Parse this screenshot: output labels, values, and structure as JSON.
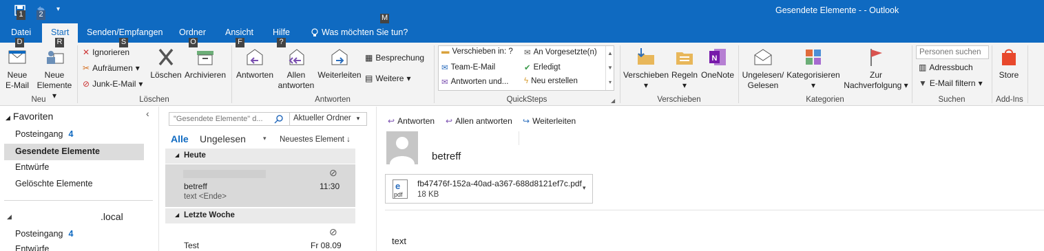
{
  "window": {
    "title": "Gesendete Elemente -  -  Outlook"
  },
  "qat": {
    "key1": "1",
    "key2": "2"
  },
  "tabs": [
    {
      "label": "Datei",
      "key": "D"
    },
    {
      "label": "Start",
      "key": "R"
    },
    {
      "label": "Senden/Empfangen",
      "key": "S"
    },
    {
      "label": "Ordner",
      "key": "O"
    },
    {
      "label": "Ansicht",
      "key": "F"
    },
    {
      "label": "Hilfe",
      "key": "?"
    },
    {
      "label": "Was möchten Sie tun?",
      "key": "M"
    }
  ],
  "ribbon": {
    "neu": {
      "label": "Neu",
      "new_email": [
        "Neue",
        "E-Mail"
      ],
      "new_items": [
        "Neue",
        "Elemente"
      ]
    },
    "loeschen": {
      "label": "Löschen",
      "ignore": "Ignorieren",
      "cleanup": "Aufräumen",
      "junk": "Junk-E-Mail",
      "delete": "Löschen",
      "archive": "Archivieren"
    },
    "antworten": {
      "label": "Antworten",
      "reply": "Antworten",
      "reply_all": [
        "Allen",
        "antworten"
      ],
      "forward": "Weiterleiten",
      "meeting": "Besprechung",
      "more": "Weitere"
    },
    "quicksteps": {
      "label": "QuickSteps",
      "items": [
        "Verschieben in: ?",
        "Team-E-Mail",
        "Antworten und...",
        "An Vorgesetzte(n)",
        "Erledigt",
        "Neu erstellen"
      ]
    },
    "verschieben": {
      "label": "Verschieben",
      "move": "Verschieben",
      "rules": "Regeln",
      "onenote": "OneNote"
    },
    "kategorien": {
      "label": "Kategorien",
      "unread": [
        "Ungelesen/",
        "Gelesen"
      ],
      "categorize": "Kategorisieren",
      "followup": [
        "Zur",
        "Nachverfolgung"
      ]
    },
    "suchen": {
      "label": "Suchen",
      "search_people_placeholder": "Personen suchen",
      "address_book": "Adressbuch",
      "filter": "E-Mail filtern"
    },
    "addins": {
      "label": "Add-Ins",
      "store": "Store"
    }
  },
  "nav": {
    "favorites": "Favoriten",
    "fav_items": [
      {
        "label": "Posteingang",
        "count": "4"
      },
      {
        "label": "Gesendete Elemente"
      },
      {
        "label": "Entwürfe"
      },
      {
        "label": "Gelöschte Elemente"
      }
    ],
    "account": ".local",
    "acct_items": [
      {
        "label": "Posteingang",
        "count": "4"
      },
      {
        "label": "Entwürfe"
      }
    ]
  },
  "list": {
    "search_placeholder": "\"Gesendete Elemente\" d...",
    "scope": "Aktueller Ordner",
    "filter_all": "Alle",
    "filter_unread": "Ungelesen",
    "sort": "Neuestes Element",
    "groups": [
      {
        "label": "Heute",
        "items": [
          {
            "subject": "betreff",
            "preview": "text <Ende>",
            "time": "11:30"
          }
        ]
      },
      {
        "label": "Letzte Woche",
        "items": [
          {
            "subject": "Test",
            "time": "Fr 08.09"
          }
        ]
      }
    ]
  },
  "reading": {
    "actions": [
      "Antworten",
      "Allen antworten",
      "Weiterleiten"
    ],
    "subject": "betreff",
    "attachment": {
      "name": "fb47476f-152a-40ad-a367-688d8121ef7c.pdf",
      "size": "18 KB",
      "ext": "pdf"
    },
    "body": "text"
  },
  "colors": {
    "accent": "#0f6ac1",
    "selected": "#dcdcdc",
    "hover": "#e8e8e8"
  }
}
